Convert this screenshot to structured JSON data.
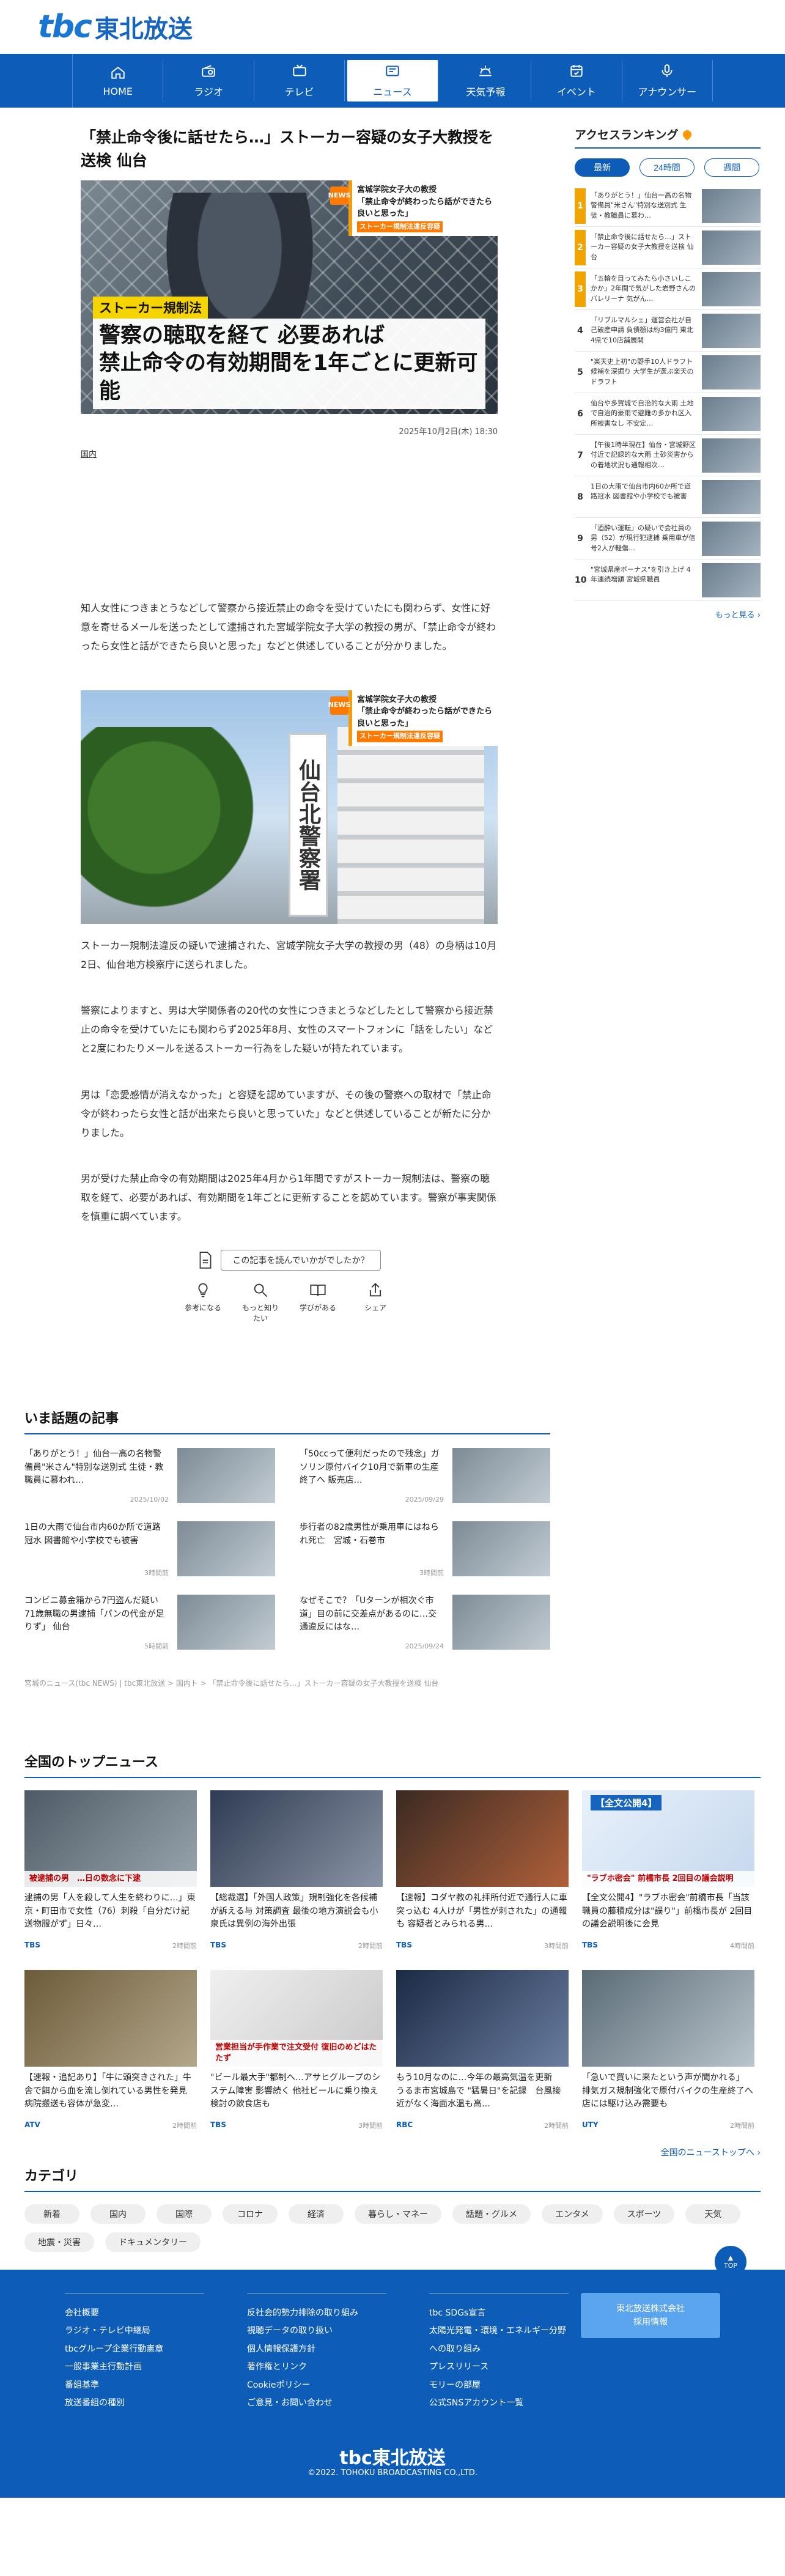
{
  "header": {
    "logo_mark": "tbc",
    "logo_name": "東北放送"
  },
  "nav": [
    {
      "label": "HOME",
      "icon": "home-icon"
    },
    {
      "label": "ラジオ",
      "icon": "radio-icon"
    },
    {
      "label": "テレビ",
      "icon": "tv-icon"
    },
    {
      "label": "ニュース",
      "icon": "news-icon",
      "active": true
    },
    {
      "label": "天気予報",
      "icon": "weather-icon"
    },
    {
      "label": "イベント",
      "icon": "event-icon"
    },
    {
      "label": "アナウンサー",
      "icon": "mic-icon"
    }
  ],
  "article": {
    "title": "「禁止命令後に話せたら…」ストーカー容疑の女子大教授を送検 仙台",
    "hero_caption_news": "NEWS",
    "hero_caption_line1": "宮城学院女子大の教授",
    "hero_caption_line2": "「禁止命令が終わったら話ができたら良いと思った」",
    "hero_caption_tag": "ストーカー規制法違反容疑",
    "hero_label": "ストーカー規制法",
    "hero_text_line1": "警察の聴取を経て 必要あれば",
    "hero_text_line2": "禁止命令の有効期間を1年ごとに更新可能",
    "date": "2025年10月2日(木) 18:30",
    "category": "国内",
    "paragraphs": [
      "知人女性につきまとうなどして警察から接近禁止の命令を受けていたにも関わらず、女性に好意を寄せるメールを送ったとして逮捕された宮城学院女子大学の教授の男が、「禁止命令が終わったら女性と話ができたら良いと思った」などと供述していることが分かりました。",
      "ストーカー規制法違反の疑いで逮捕された、宮城学院女子大学の教授の男（48）の身柄は10月2日、仙台地方検察庁に送られました。",
      "警察によりますと、男は大学関係者の20代の女性につきまとうなどしたとして警察から接近禁止の命令を受けていたにも関わらず2025年8月、女性のスマートフォンに「話をしたい」などと2度にわたりメールを送るストーカー行為をした疑いが持たれています。",
      "男は「恋愛感情が消えなかった」と容疑を認めていますが、その後の警察への取材で「禁止命令が終わったら女性と話が出来たら良いと思っていた」などと供述していることが新たに分かりました。",
      "男が受けた禁止命令の有効期間は2025年4月から1年間ですがストーカー規制法は、警察の聴取を経て、必要があれば、有効期間を1年ごとに更新することを認めています。警察が事実関係を慎重に調べています。"
    ],
    "photo2_sign": "仙台北警察署",
    "photo2_caption_line1": "宮城学院女子大の教授",
    "photo2_caption_line2": "「禁止命令が終わったら話ができたら良いと思った」",
    "photo2_caption_tag": "ストーカー規制法違反容疑"
  },
  "feedback": {
    "question": "この記事を読んでいかがでしたか？",
    "buttons": [
      {
        "label": "参考になる",
        "icon": "lightbulb-icon"
      },
      {
        "label": "もっと知りたい",
        "icon": "search-icon"
      },
      {
        "label": "学びがある",
        "icon": "book-icon"
      },
      {
        "label": "シェア",
        "icon": "share-icon"
      }
    ]
  },
  "ranking": {
    "title": "アクセスランキング",
    "tabs": [
      "最新",
      "24時間",
      "週間"
    ],
    "items": [
      {
        "num": "1",
        "text": "「ありがとう！」仙台一高の名物警備員\"米さん\"特別な送別式 生徒・教職員に慕わ…"
      },
      {
        "num": "2",
        "text": "「禁止命令後に話せたら…」ストーカー容疑の女子大教授を送検 仙台"
      },
      {
        "num": "3",
        "text": "「五輪を目ってみたら小さいしこかか」2年間で気がした岩野さんのバレリーナ 気がん…"
      },
      {
        "num": "4",
        "text": "「リブルマルシェ」運営会社が自己破産申請 負債額は約3億円 東北4県で10店舗展開"
      },
      {
        "num": "5",
        "text": "\"楽天史上初\"の野手10人ドラフト候補を深掘り 大学生が選ぶ楽天のドラフト"
      },
      {
        "num": "6",
        "text": "仙台や多賀城で自治的な大雨 土地で自治的豪雨で避難の多かれ区入所被害なし 不安定…"
      },
      {
        "num": "7",
        "text": "【午後1時半現在】仙台・宮城野区付近で記録的な大雨 土砂災害からの着地状況も通報相次…"
      },
      {
        "num": "8",
        "text": "1日の大雨で仙台市内60か所で道路冠水 図書館や小学校でも被害"
      },
      {
        "num": "9",
        "text": "「酒酔い運転」の疑いで会社員の男（52）が現行犯逮捕 乗用車が信号2人が軽傷…"
      },
      {
        "num": "10",
        "text": "\"宮城県産ボーナス\"を引き上げ 4年連続増額 宮城県職員"
      }
    ],
    "more": "もっと見る"
  },
  "trending": {
    "title": "いま話題の記事",
    "items": [
      {
        "text": "「ありがとう！」仙台一高の名物警備員\"米さん\"特別な送別式 生徒・教職員に慕われ…",
        "ago": "2025/10/02"
      },
      {
        "text": "「50ccって便利だったので残念」ガソリン原付バイク10月で新車の生産終了へ 販売店…",
        "ago": "2025/09/29"
      },
      {
        "text": "1日の大雨で仙台市内60か所で道路冠水 図書館や小学校でも被害",
        "ago": "3時間前"
      },
      {
        "text": "歩行者の82歳男性が乗用車にはねられ死亡　宮城・石巻市",
        "ago": "3時間前"
      },
      {
        "text": "コンビニ募金箱から7円盗んだ疑い 71歳無職の男逮捕「パンの代金が足りず」 仙台",
        "ago": "5時間前"
      },
      {
        "text": "なぜそこで？「Uターンが相次ぐ市道」目の前に交差点があるのに…交通違反にはな…",
        "ago": "2025/09/24"
      }
    ],
    "breadcrumb": "宮城のニュース(tbc NEWS) | tbc東北放送 > 国内ト > 「禁止命令後に話せたら…」ストーカー容疑の女子大教授を送検 仙台"
  },
  "national": {
    "title": "全国のトップニュース",
    "items": [
      {
        "text": "逮捕の男「人を殺して人生を終わりに…」東京・町田市で女性（76）刺殺「自分だけ記送物服がず」日々…",
        "src": "TBS",
        "ago": "2時間前",
        "badge": "",
        "overlay": "被逮捕の男　…日の数念に下逮"
      },
      {
        "text": "【総裁選】「外国人政策」規制強化を各候補が訴える与 対策調査 最後の地方演説会も小泉氏は異例の海外出張",
        "src": "TBS",
        "ago": "2時間前",
        "badge": "",
        "overlay": ""
      },
      {
        "text": "【速報】コダヤ教の礼拝所付近で通行人に車突っ込む 4人けが「男性が刺された」の通報も 容疑者とみられる男…",
        "src": "TBS",
        "ago": "3時間前",
        "badge": "",
        "overlay": ""
      },
      {
        "text": "【全文公開4】\"ラブホ密会\"前橋市長「当該職員の藤積成分は\"誤り\"」前橋市長が 2回目の議会説明後に会見",
        "src": "TBS",
        "ago": "4時間前",
        "badge": "【全文公開4】",
        "overlay": "\"ラブホ密会\" 前橋市長 2回目の議会説明"
      },
      {
        "text": "【速報・追記あり】「牛に頭突きされた」牛舎で餌から血を流し倒れている男性を発見　病院搬送も容体が急変…",
        "src": "ATV",
        "ago": "2時間前",
        "badge": "",
        "overlay": ""
      },
      {
        "text": "\"ビール最大手\"都制へ…アサヒグループのシステム障害 影響続く 他社ビールに乗り換え検討の飲食店も",
        "src": "TBS",
        "ago": "3時間前",
        "badge": "",
        "overlay": "営業担当が手作業で注文受付 復旧のめどはたたず"
      },
      {
        "text": "もう10月なのに…今年の最高気温を更新　うるま市宮城島で \"猛暑日\"を記録　台風接近がなく海面水温も高…",
        "src": "RBC",
        "ago": "2時間前",
        "badge": "",
        "overlay": ""
      },
      {
        "text": "「急いで買いに来たという声が聞かれる」 排気ガス規制強化で原付バイクの生産終了へ　店には駆け込み需要も",
        "src": "UTY",
        "ago": "2時間前",
        "badge": "",
        "overlay": ""
      }
    ],
    "all_link": "全国のニューストップへ"
  },
  "categories": {
    "title": "カテゴリ",
    "items": [
      "新着",
      "国内",
      "国際",
      "コロナ",
      "経済",
      "暮らし・マネー",
      "話題・グルメ",
      "エンタメ",
      "スポーツ",
      "天気",
      "地震・災害",
      "ドキュメンタリー"
    ]
  },
  "footer": {
    "col1": [
      "会社概要",
      "ラジオ・テレビ中継局",
      "tbcグループ企業行動憲章",
      "一般事業主行動計画",
      "番組基準",
      "放送番組の種別"
    ],
    "col2": [
      "反社会的勢力排除の取り組み",
      "視聴データの取り扱い",
      "個人情報保護方針",
      "著作権とリンク",
      "Cookieポリシー",
      "ご意見・お問い合わせ"
    ],
    "col3": [
      "tbc SDGs宣言",
      "太陽光発電・環境・エネルギー分野への取り組み",
      "プレスリリース",
      "モリーの部屋",
      "公式SNSアカウント一覧"
    ],
    "recruit_line1": "東北放送株式会社",
    "recruit_line2": "採用情報",
    "logo": "tbc東北放送",
    "copyright": "©2022. TOHOKU BROADCASTING CO.,LTD.",
    "top_label": "TOP"
  },
  "colors": {
    "brand": "#0d5db8",
    "accent": "#f0a400",
    "label_yellow": "#f5d400"
  }
}
